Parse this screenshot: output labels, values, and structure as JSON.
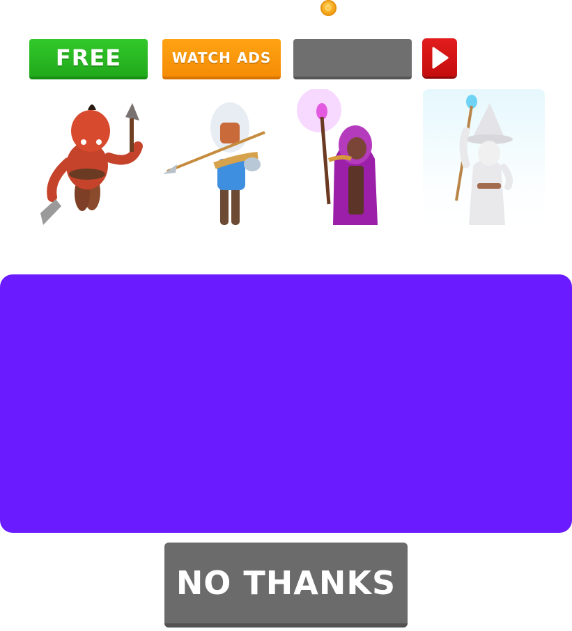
{
  "currency": {
    "icon": "coin-icon"
  },
  "offers": {
    "free_label": "FREE",
    "watch_ads_label": "WATCH ADS",
    "locked_label": "",
    "play_icon": "play-icon"
  },
  "characters": [
    {
      "name": "",
      "icon": "red-orc-warrior-icon"
    },
    {
      "name": "",
      "icon": "spearman-knight-icon"
    },
    {
      "name": "",
      "icon": "purple-mage-icon"
    },
    {
      "name": "",
      "icon": "white-wizard-icon"
    }
  ],
  "panel": {
    "color": "#6b1bff"
  },
  "footer": {
    "no_thanks_label": "NO THANKS"
  },
  "colors": {
    "free": "#2cc225",
    "watch_ads": "#ff9a0c",
    "locked": "#6f6f6f",
    "play": "#d71515",
    "no_thanks": "#6b6b6b"
  }
}
